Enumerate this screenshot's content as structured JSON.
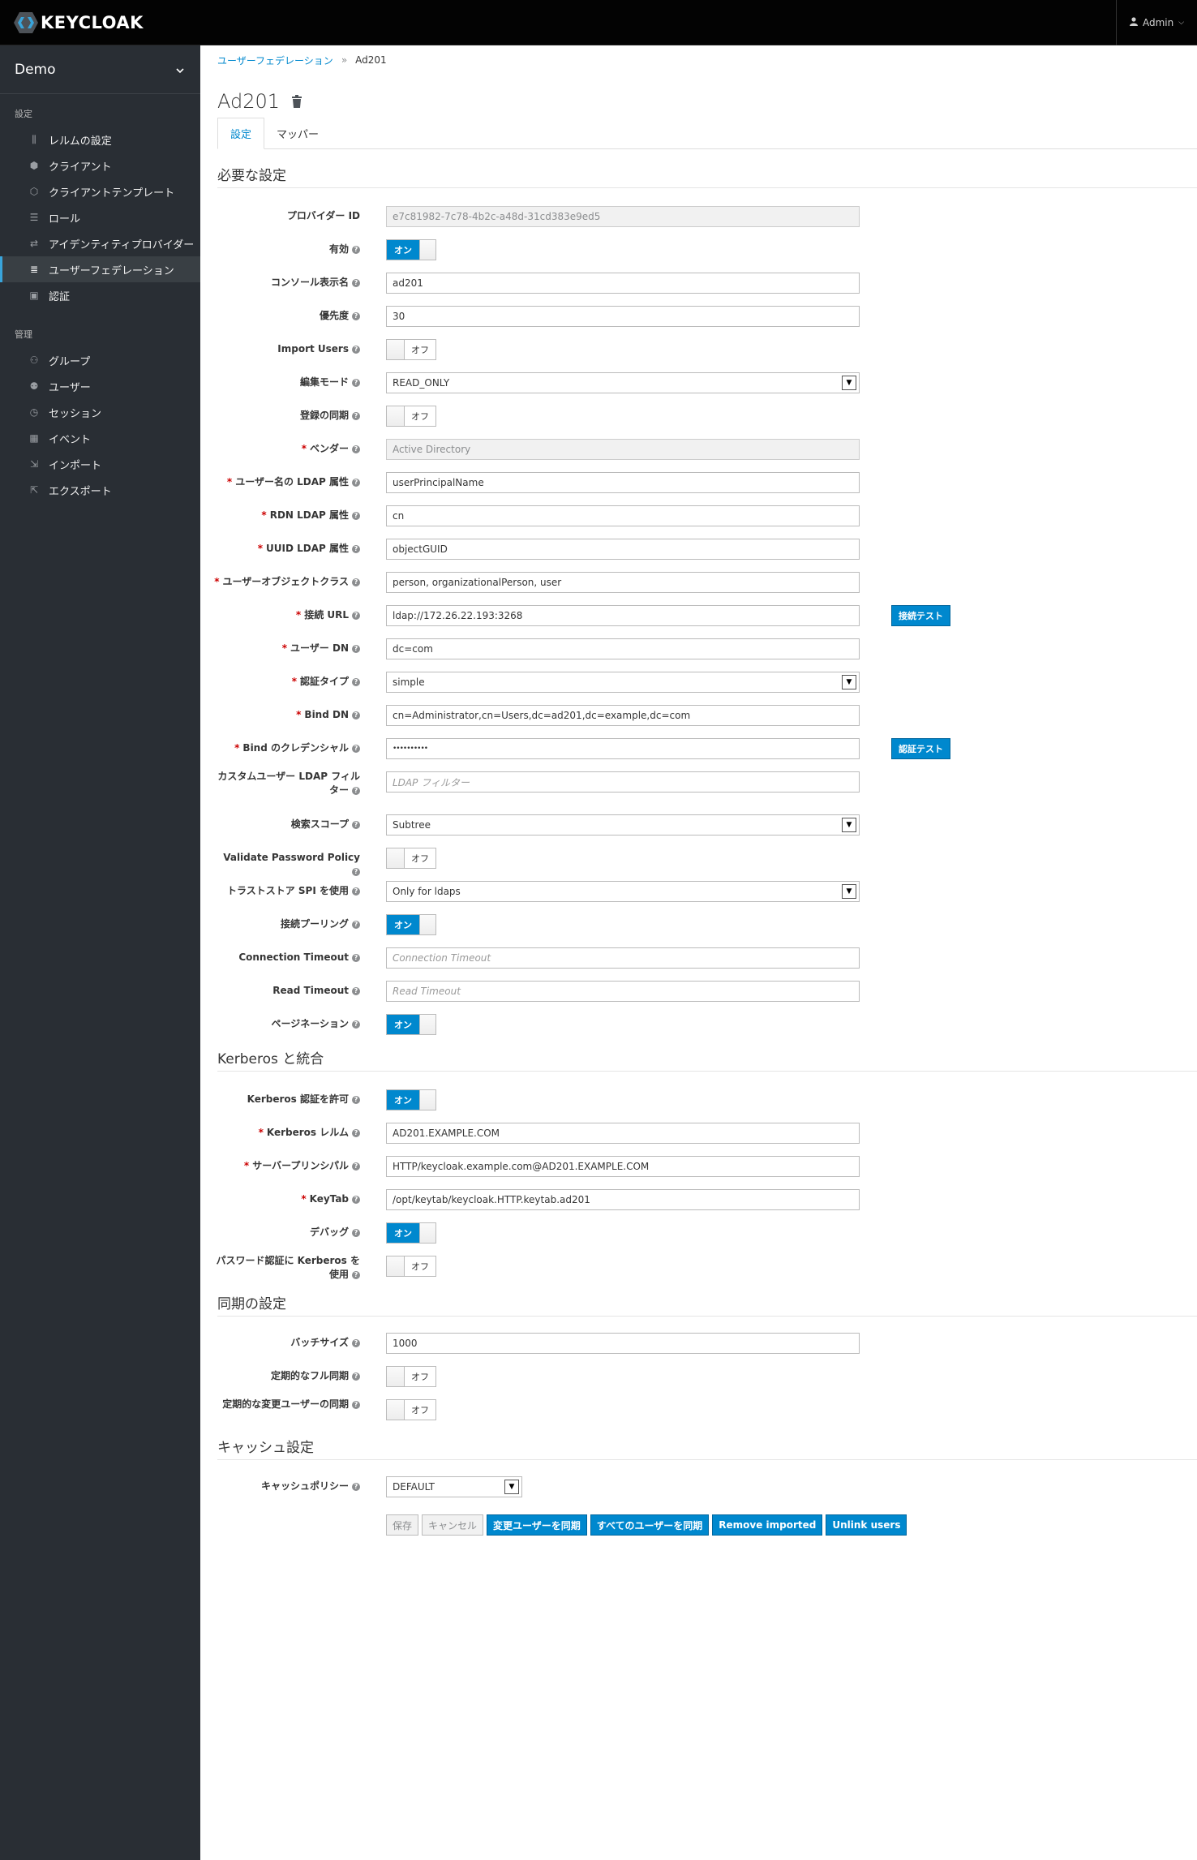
{
  "app": {
    "logo_text": "KEYCLOAK",
    "user": "Admin"
  },
  "sidebar": {
    "realm": "Demo",
    "section_settings": "設定",
    "settings_items": [
      {
        "label": "レルムの設定",
        "icon": "sliders-icon"
      },
      {
        "label": "クライアント",
        "icon": "cube-icon"
      },
      {
        "label": "クライアントテンプレート",
        "icon": "cubes-icon"
      },
      {
        "label": "ロール",
        "icon": "list-icon"
      },
      {
        "label": "アイデンティティプロバイダー",
        "icon": "exchange-icon"
      },
      {
        "label": "ユーザーフェデレーション",
        "icon": "database-icon"
      },
      {
        "label": "認証",
        "icon": "lock-icon"
      }
    ],
    "section_manage": "管理",
    "manage_items": [
      {
        "label": "グループ",
        "icon": "users-icon"
      },
      {
        "label": "ユーザー",
        "icon": "user-icon"
      },
      {
        "label": "セッション",
        "icon": "clock-icon"
      },
      {
        "label": "イベント",
        "icon": "calendar-icon"
      },
      {
        "label": "インポート",
        "icon": "import-icon"
      },
      {
        "label": "エクスポート",
        "icon": "export-icon"
      }
    ]
  },
  "breadcrumb": {
    "parent": "ユーザーフェデレーション",
    "sep": "»",
    "current": "Ad201"
  },
  "title": "Ad201",
  "tabs": {
    "settings": "設定",
    "mappers": "マッパー"
  },
  "sections": {
    "required": "必要な設定",
    "kerberos": "Kerberos と統合",
    "sync": "同期の設定",
    "cache": "キャッシュ設定"
  },
  "fields": {
    "provider_id": {
      "label": "プロバイダー ID",
      "value": "e7c81982-7c78-4b2c-a48d-31cd383e9ed5"
    },
    "enabled": {
      "label": "有効",
      "state": "オン"
    },
    "console_name": {
      "label": "コンソール表示名",
      "value": "ad201"
    },
    "priority": {
      "label": "優先度",
      "value": "30"
    },
    "import_users": {
      "label": "Import Users",
      "state": "オフ"
    },
    "edit_mode": {
      "label": "編集モード",
      "value": "READ_ONLY"
    },
    "sync_registrations": {
      "label": "登録の同期",
      "state": "オフ"
    },
    "vendor": {
      "label": "ベンダー",
      "value": "Active Directory"
    },
    "username_attr": {
      "label": "ユーザー名の LDAP 属性",
      "value": "userPrincipalName"
    },
    "rdn_attr": {
      "label": "RDN LDAP 属性",
      "value": "cn"
    },
    "uuid_attr": {
      "label": "UUID LDAP 属性",
      "value": "objectGUID"
    },
    "user_object_classes": {
      "label": "ユーザーオブジェクトクラス",
      "value": "person, organizationalPerson, user"
    },
    "connection_url": {
      "label": "接続 URL",
      "value": "ldap://172.26.22.193:3268",
      "button": "接続テスト"
    },
    "users_dn": {
      "label": "ユーザー DN",
      "value": "dc=com"
    },
    "auth_type": {
      "label": "認証タイプ",
      "value": "simple"
    },
    "bind_dn": {
      "label": "Bind DN",
      "value": "cn=Administrator,cn=Users,dc=ad201,dc=example,dc=com"
    },
    "bind_credential": {
      "label": "Bind のクレデンシャル",
      "value": "••••••••••",
      "button": "認証テスト"
    },
    "custom_filter": {
      "label": "カスタムユーザー LDAP フィルター",
      "placeholder": "LDAP フィルター"
    },
    "search_scope": {
      "label": "検索スコープ",
      "value": "Subtree"
    },
    "validate_password_policy": {
      "label": "Validate Password Policy",
      "state": "オフ"
    },
    "truststore_spi": {
      "label": "トラストストア SPI を使用",
      "value": "Only for ldaps"
    },
    "connection_pooling": {
      "label": "接続プーリング",
      "state": "オン"
    },
    "connection_timeout": {
      "label": "Connection Timeout",
      "placeholder": "Connection Timeout"
    },
    "read_timeout": {
      "label": "Read Timeout",
      "placeholder": "Read Timeout"
    },
    "pagination": {
      "label": "ページネーション",
      "state": "オン"
    },
    "allow_kerberos": {
      "label": "Kerberos 認証を許可",
      "state": "オン"
    },
    "kerberos_realm": {
      "label": "Kerberos レルム",
      "value": "AD201.EXAMPLE.COM"
    },
    "server_principal": {
      "label": "サーバープリンシパル",
      "value": "HTTP/keycloak.example.com@AD201.EXAMPLE.COM"
    },
    "keytab": {
      "label": "KeyTab",
      "value": "/opt/keytab/keycloak.HTTP.keytab.ad201"
    },
    "debug": {
      "label": "デバッグ",
      "state": "オン"
    },
    "use_kerberos_pw": {
      "label": "パスワード認証に Kerberos を使用",
      "state": "オフ"
    },
    "batch_size": {
      "label": "バッチサイズ",
      "value": "1000"
    },
    "periodic_full_sync": {
      "label": "定期的なフル同期",
      "state": "オフ"
    },
    "periodic_changed_sync": {
      "label": "定期的な変更ユーザーの同期",
      "state": "オフ"
    },
    "cache_policy": {
      "label": "キャッシュポリシー",
      "value": "DEFAULT"
    }
  },
  "actions": {
    "save": "保存",
    "cancel": "キャンセル",
    "sync_changed": "変更ユーザーを同期",
    "sync_all": "すべてのユーザーを同期",
    "remove_imported": "Remove imported",
    "unlink_users": "Unlink users"
  },
  "colors": {
    "accent": "#0088ce",
    "sidebar": "#292e34",
    "topbar": "#030303"
  }
}
